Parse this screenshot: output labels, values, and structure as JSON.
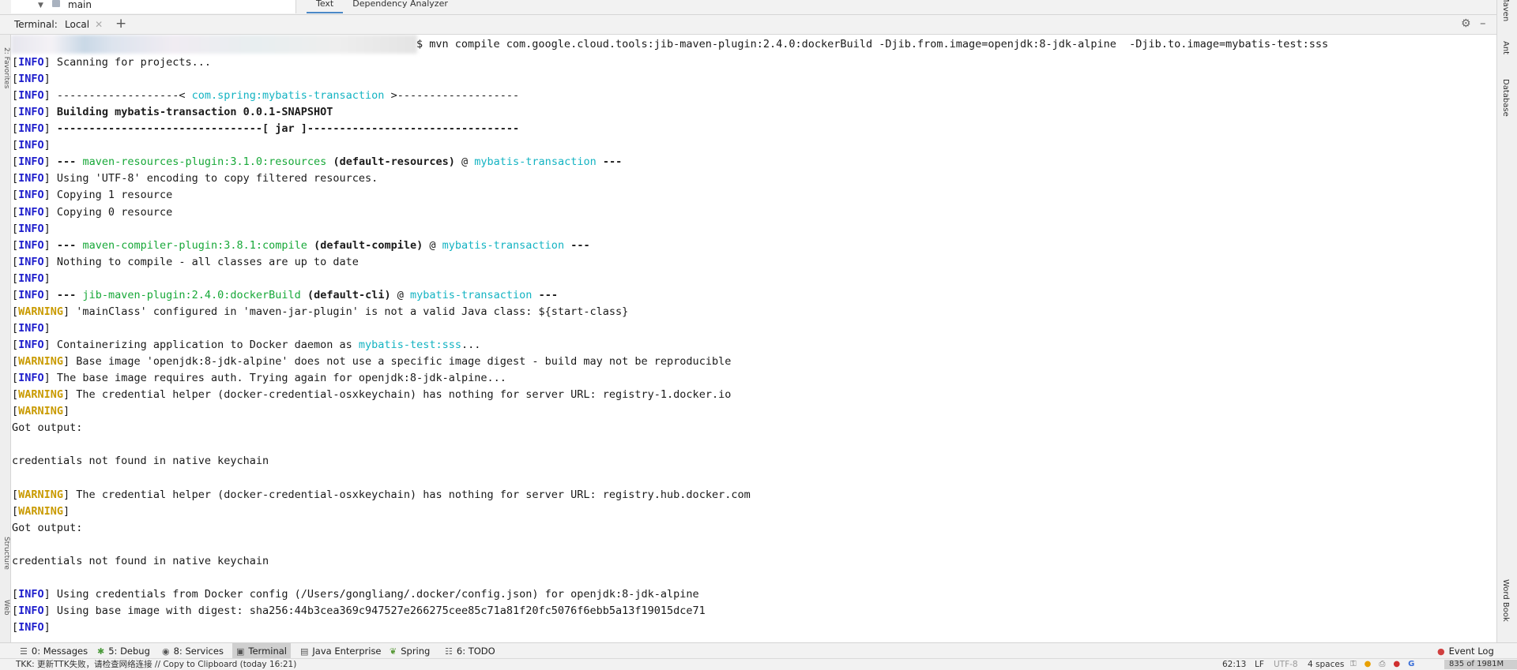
{
  "project_tree": {
    "item_label": "main"
  },
  "editor_tabs": [
    "Text",
    "Dependency Analyzer"
  ],
  "terminal": {
    "title": "Terminal:",
    "tab_label": "Local",
    "command": "$ mvn compile com.google.cloud.tools:jib-maven-plugin:2.4.0:dockerBuild -Djib.from.image=openjdk:8-jdk-alpine  -Djib.to.image=mybatis-test:sss",
    "lines": [
      [
        {
          "t": "[",
          "c": ""
        },
        {
          "t": "INFO",
          "c": "info"
        },
        {
          "t": "] Scanning for projects...",
          "c": ""
        }
      ],
      [
        {
          "t": "[",
          "c": ""
        },
        {
          "t": "INFO",
          "c": "info"
        },
        {
          "t": "]",
          "c": ""
        }
      ],
      [
        {
          "t": "[",
          "c": ""
        },
        {
          "t": "INFO",
          "c": "info"
        },
        {
          "t": "] -------------------< ",
          "c": ""
        },
        {
          "t": "com.spring:mybatis-transaction",
          "c": "cyan"
        },
        {
          "t": " >-------------------",
          "c": ""
        }
      ],
      [
        {
          "t": "[",
          "c": ""
        },
        {
          "t": "INFO",
          "c": "info"
        },
        {
          "t": "] ",
          "c": ""
        },
        {
          "t": "Building mybatis-transaction 0.0.1-SNAPSHOT",
          "c": "bold"
        }
      ],
      [
        {
          "t": "[",
          "c": ""
        },
        {
          "t": "INFO",
          "c": "info"
        },
        {
          "t": "] ",
          "c": ""
        },
        {
          "t": "--------------------------------[ jar ]---------------------------------",
          "c": "bold"
        }
      ],
      [
        {
          "t": "[",
          "c": ""
        },
        {
          "t": "INFO",
          "c": "info"
        },
        {
          "t": "]",
          "c": ""
        }
      ],
      [
        {
          "t": "[",
          "c": ""
        },
        {
          "t": "INFO",
          "c": "info"
        },
        {
          "t": "] ",
          "c": ""
        },
        {
          "t": "---",
          "c": "bold"
        },
        {
          "t": " ",
          "c": ""
        },
        {
          "t": "maven-resources-plugin:3.1.0:resources",
          "c": "green"
        },
        {
          "t": " ",
          "c": ""
        },
        {
          "t": "(default-resources)",
          "c": "bold"
        },
        {
          "t": " @ ",
          "c": ""
        },
        {
          "t": "mybatis-transaction",
          "c": "cyan"
        },
        {
          "t": " ",
          "c": ""
        },
        {
          "t": "---",
          "c": "bold"
        }
      ],
      [
        {
          "t": "[",
          "c": ""
        },
        {
          "t": "INFO",
          "c": "info"
        },
        {
          "t": "] Using 'UTF-8' encoding to copy filtered resources.",
          "c": ""
        }
      ],
      [
        {
          "t": "[",
          "c": ""
        },
        {
          "t": "INFO",
          "c": "info"
        },
        {
          "t": "] Copying 1 resource",
          "c": ""
        }
      ],
      [
        {
          "t": "[",
          "c": ""
        },
        {
          "t": "INFO",
          "c": "info"
        },
        {
          "t": "] Copying 0 resource",
          "c": ""
        }
      ],
      [
        {
          "t": "[",
          "c": ""
        },
        {
          "t": "INFO",
          "c": "info"
        },
        {
          "t": "]",
          "c": ""
        }
      ],
      [
        {
          "t": "[",
          "c": ""
        },
        {
          "t": "INFO",
          "c": "info"
        },
        {
          "t": "] ",
          "c": ""
        },
        {
          "t": "---",
          "c": "bold"
        },
        {
          "t": " ",
          "c": ""
        },
        {
          "t": "maven-compiler-plugin:3.8.1:compile",
          "c": "green"
        },
        {
          "t": " ",
          "c": ""
        },
        {
          "t": "(default-compile)",
          "c": "bold"
        },
        {
          "t": " @ ",
          "c": ""
        },
        {
          "t": "mybatis-transaction",
          "c": "cyan"
        },
        {
          "t": " ",
          "c": ""
        },
        {
          "t": "---",
          "c": "bold"
        }
      ],
      [
        {
          "t": "[",
          "c": ""
        },
        {
          "t": "INFO",
          "c": "info"
        },
        {
          "t": "] Nothing to compile - all classes are up to date",
          "c": ""
        }
      ],
      [
        {
          "t": "[",
          "c": ""
        },
        {
          "t": "INFO",
          "c": "info"
        },
        {
          "t": "]",
          "c": ""
        }
      ],
      [
        {
          "t": "[",
          "c": ""
        },
        {
          "t": "INFO",
          "c": "info"
        },
        {
          "t": "] ",
          "c": ""
        },
        {
          "t": "---",
          "c": "bold"
        },
        {
          "t": " ",
          "c": ""
        },
        {
          "t": "jib-maven-plugin:2.4.0:dockerBuild",
          "c": "green"
        },
        {
          "t": " ",
          "c": ""
        },
        {
          "t": "(default-cli)",
          "c": "bold"
        },
        {
          "t": " @ ",
          "c": ""
        },
        {
          "t": "mybatis-transaction",
          "c": "cyan"
        },
        {
          "t": " ",
          "c": ""
        },
        {
          "t": "---",
          "c": "bold"
        }
      ],
      [
        {
          "t": "[",
          "c": ""
        },
        {
          "t": "WARNING",
          "c": "warn"
        },
        {
          "t": "] 'mainClass' configured in 'maven-jar-plugin' is not a valid Java class: ${start-class}",
          "c": ""
        }
      ],
      [
        {
          "t": "[",
          "c": ""
        },
        {
          "t": "INFO",
          "c": "info"
        },
        {
          "t": "]",
          "c": ""
        }
      ],
      [
        {
          "t": "[",
          "c": ""
        },
        {
          "t": "INFO",
          "c": "info"
        },
        {
          "t": "] Containerizing application to Docker daemon as ",
          "c": ""
        },
        {
          "t": "mybatis-test:sss",
          "c": "cyan"
        },
        {
          "t": "...",
          "c": ""
        }
      ],
      [
        {
          "t": "[",
          "c": ""
        },
        {
          "t": "WARNING",
          "c": "warn"
        },
        {
          "t": "] Base image 'openjdk:8-jdk-alpine' does not use a specific image digest - build may not be reproducible",
          "c": ""
        }
      ],
      [
        {
          "t": "[",
          "c": ""
        },
        {
          "t": "INFO",
          "c": "info"
        },
        {
          "t": "] The base image requires auth. Trying again for openjdk:8-jdk-alpine...",
          "c": ""
        }
      ],
      [
        {
          "t": "[",
          "c": ""
        },
        {
          "t": "WARNING",
          "c": "warn"
        },
        {
          "t": "] The credential helper (docker-credential-osxkeychain) has nothing for server URL: registry-1.docker.io",
          "c": ""
        }
      ],
      [
        {
          "t": "[",
          "c": ""
        },
        {
          "t": "WARNING",
          "c": "warn"
        },
        {
          "t": "]",
          "c": ""
        }
      ],
      [
        {
          "t": "Got output:",
          "c": ""
        }
      ],
      [],
      [
        {
          "t": "credentials not found in native keychain",
          "c": ""
        }
      ],
      [],
      [
        {
          "t": "[",
          "c": ""
        },
        {
          "t": "WARNING",
          "c": "warn"
        },
        {
          "t": "] The credential helper (docker-credential-osxkeychain) has nothing for server URL: registry.hub.docker.com",
          "c": ""
        }
      ],
      [
        {
          "t": "[",
          "c": ""
        },
        {
          "t": "WARNING",
          "c": "warn"
        },
        {
          "t": "]",
          "c": ""
        }
      ],
      [
        {
          "t": "Got output:",
          "c": ""
        }
      ],
      [],
      [
        {
          "t": "credentials not found in native keychain",
          "c": ""
        }
      ],
      [],
      [
        {
          "t": "[",
          "c": ""
        },
        {
          "t": "INFO",
          "c": "info"
        },
        {
          "t": "] Using credentials from Docker config (/Users/gongliang/.docker/config.json) for openjdk:8-jdk-alpine",
          "c": ""
        }
      ],
      [
        {
          "t": "[",
          "c": ""
        },
        {
          "t": "INFO",
          "c": "info"
        },
        {
          "t": "] Using base image with digest: sha256:44b3cea369c947527e266275cee85c71a81f20fc5076f6ebb5a13f19015dce71",
          "c": ""
        }
      ],
      [
        {
          "t": "[",
          "c": ""
        },
        {
          "t": "INFO",
          "c": "info"
        },
        {
          "t": "]",
          "c": ""
        }
      ]
    ]
  },
  "left_strip_labels": [
    "2: Favorites",
    "Structure",
    "Web"
  ],
  "right_strip_labels": [
    "Maven",
    "Ant",
    "Database",
    "Word Book"
  ],
  "tool_windows": [
    {
      "id": "messages",
      "icon": "messages-icon",
      "glyph": "☰",
      "label": "0: Messages"
    },
    {
      "id": "debug",
      "icon": "bug-icon",
      "glyph": "✱",
      "label": "5: Debug"
    },
    {
      "id": "services",
      "icon": "services-icon",
      "glyph": "◉",
      "label": "8: Services"
    },
    {
      "id": "terminal",
      "icon": "terminal-icon",
      "glyph": "▣",
      "label": "Terminal",
      "active": true
    },
    {
      "id": "java-enterprise",
      "icon": "java-enterprise-icon",
      "glyph": "▤",
      "label": "Java Enterprise"
    },
    {
      "id": "spring",
      "icon": "spring-icon",
      "glyph": "❦",
      "label": "Spring"
    },
    {
      "id": "todo",
      "icon": "todo-icon",
      "glyph": "☷",
      "label": "6: TODO"
    }
  ],
  "event_log": {
    "label": "Event Log",
    "icon": "event-log-icon"
  },
  "status": {
    "message": "TKK: 更新TTK失败，请检查网络连接 // Copy to Clipboard (today 16:21)",
    "position": "62:13",
    "line_sep": "LF",
    "encoding": "UTF-8",
    "indent": "4 spaces",
    "memory": "835 of 1981M"
  },
  "colors": {
    "info": "#1e1ecc",
    "warning": "#c99a00",
    "plugin": "#17a838",
    "artifact": "#13b3c2"
  }
}
